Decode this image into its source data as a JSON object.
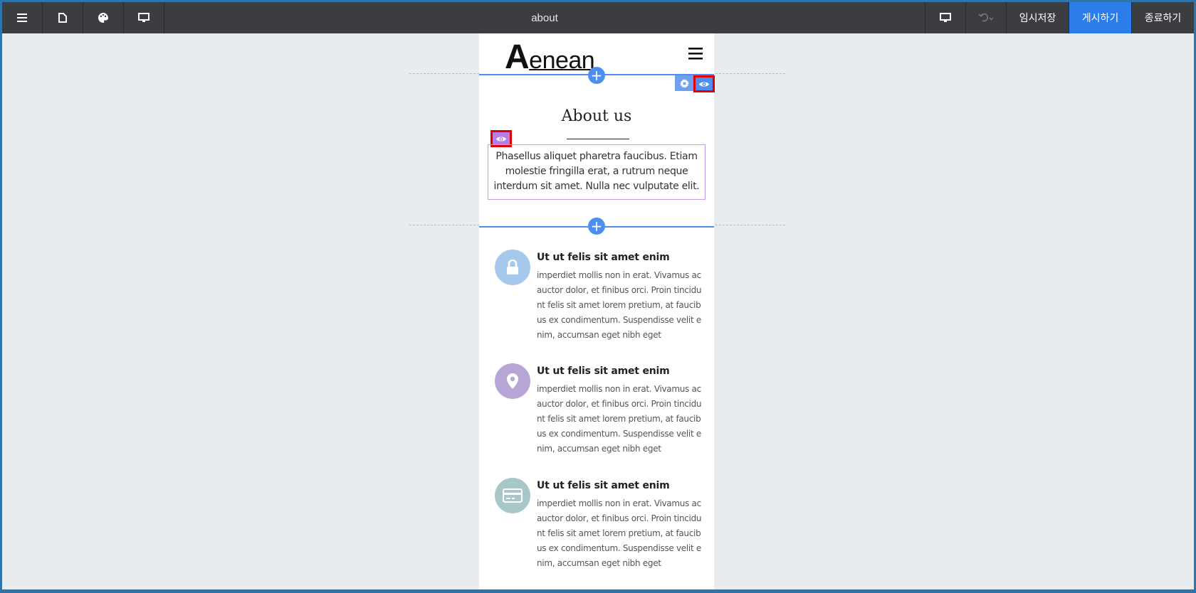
{
  "toolbar": {
    "title": "about",
    "save_label": "임시저장",
    "publish_label": "게시하기",
    "exit_label": "종료하기",
    "publish_color": "#2b7de9"
  },
  "site": {
    "logo_initial": "A",
    "logo_rest": "enean"
  },
  "about": {
    "title": "About us",
    "text": "Phasellus aliquet pharetra faucibus. Etiam molestie fringilla erat, a rutrum neque interdum sit amet. Nulla nec vulputate elit."
  },
  "features": [
    {
      "icon": "lock-icon",
      "color": "#a6c8ec",
      "title": "Ut ut felis sit amet enim",
      "body": "imperdiet mollis non in erat. Vivamus ac auctor dolor, et finibus orci. Proin tincidunt felis sit amet lorem pretium, at faucibus ex condimentum. Suspendisse velit enim, accumsan eget nibh eget"
    },
    {
      "icon": "map-pin-icon",
      "color": "#b7a5d6",
      "title": "Ut ut felis sit amet enim",
      "body": "imperdiet mollis non in erat. Vivamus ac auctor dolor, et finibus orci. Proin tincidunt felis sit amet lorem pretium, at faucibus ex condimentum. Suspendisse velit enim, accumsan eget nibh eget"
    },
    {
      "icon": "credit-card-icon",
      "color": "#a9c6c8",
      "title": "Ut ut felis sit amet enim",
      "body": "imperdiet mollis non in erat. Vivamus ac auctor dolor, et finibus orci. Proin tincidunt felis sit amet lorem pretium, at faucibus ex condimentum. Suspendisse velit enim, accumsan eget nibh eget"
    }
  ]
}
